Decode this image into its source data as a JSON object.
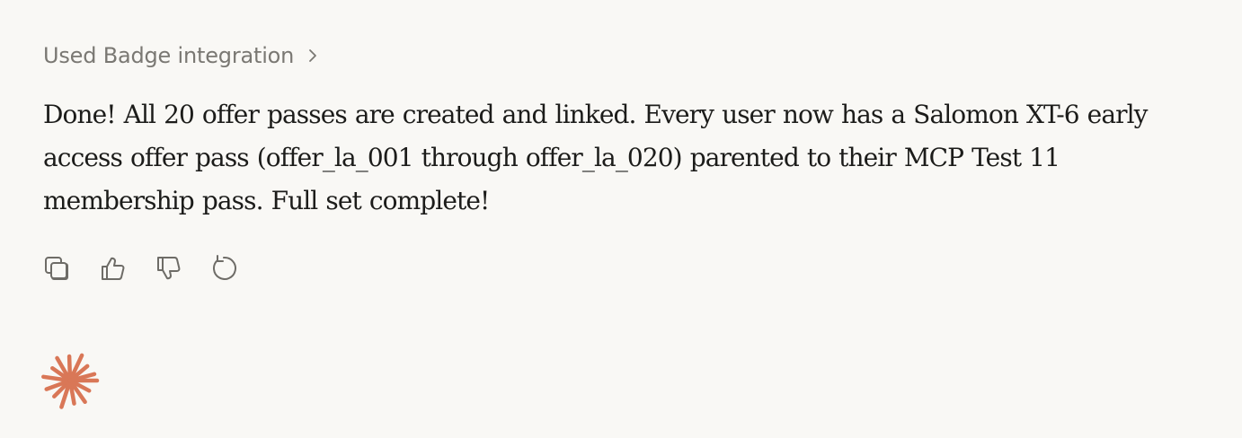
{
  "tool_use": {
    "label": "Used Badge integration",
    "chevron_icon": "chevron-right-icon"
  },
  "message": {
    "text": "Done! All 20 offer passes are created and linked. Every user now has a Salomon XT-6 early access offer pass (offer_la_001 through offer_la_020) parented to their MCP Test 11 membership pass. Full set complete!"
  },
  "actions": [
    {
      "name": "copy",
      "icon": "copy-icon"
    },
    {
      "name": "thumbs-up",
      "icon": "thumbs-up-icon"
    },
    {
      "name": "thumbs-down",
      "icon": "thumbs-down-icon"
    },
    {
      "name": "retry",
      "icon": "retry-icon"
    }
  ],
  "colors": {
    "background": "#f9f8f5",
    "text": "#1c1c1a",
    "muted": "#7a7873",
    "icon": "#6e6c67",
    "accent": "#d97757"
  },
  "logo": {
    "icon": "claude-starburst-icon"
  }
}
